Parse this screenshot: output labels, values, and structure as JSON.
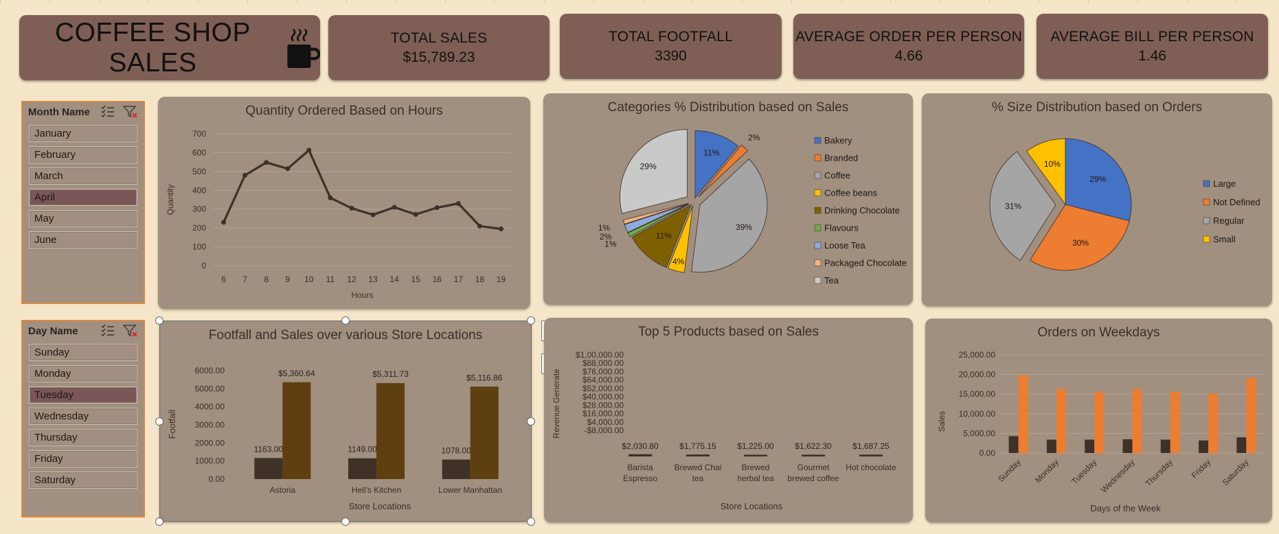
{
  "header": {
    "title": "COFFEE SHOP SALES",
    "kpis": [
      {
        "label": "TOTAL SALES",
        "value": "$15,789.23"
      },
      {
        "label": "TOTAL FOOTFALL",
        "value": "3390"
      },
      {
        "label": "AVERAGE ORDER PER PERSON",
        "value": "4.66"
      },
      {
        "label": "AVERAGE BILL PER PERSON",
        "value": "1.46"
      }
    ]
  },
  "month_slicer": {
    "header": "Month Name",
    "items": [
      "January",
      "February",
      "March",
      "April",
      "May",
      "June"
    ],
    "selected": "April"
  },
  "day_slicer": {
    "header": "Day Name",
    "items": [
      "Sunday",
      "Monday",
      "Tuesday",
      "Wednesday",
      "Thursday",
      "Friday",
      "Saturday"
    ],
    "selected": "Tuesday"
  },
  "chart_data": [
    {
      "id": "hours",
      "type": "line",
      "title": "Quantity Ordered Based on Hours",
      "xlabel": "Hours",
      "ylabel": "Quantity",
      "x": [
        6,
        7,
        8,
        9,
        10,
        11,
        12,
        13,
        14,
        15,
        16,
        17,
        18,
        19
      ],
      "values": [
        230,
        480,
        548,
        515,
        613,
        360,
        305,
        270,
        310,
        272,
        308,
        330,
        210,
        195
      ],
      "ylim": [
        0,
        700
      ],
      "yticks": [
        0,
        100,
        200,
        300,
        400,
        500,
        600,
        700
      ],
      "color": "#3e3128"
    },
    {
      "id": "categories",
      "type": "pie",
      "title": "Categories % Distribution based on Sales",
      "labels": [
        "Bakery",
        "Branded",
        "Coffee",
        "Coffee beans",
        "Drinking Chocolate",
        "Flavours",
        "Loose Tea",
        "Packaged Chocolate",
        "Tea"
      ],
      "values": [
        11,
        2,
        39,
        4,
        11,
        1,
        2,
        1,
        29
      ],
      "data_labels": [
        "11%",
        "2%",
        "39%",
        "4%",
        "11%",
        "1%",
        "2%",
        "1%",
        "29%"
      ],
      "colors": [
        "#4472c4",
        "#ed7d31",
        "#a5a5a5",
        "#ffc000",
        "#7f6000",
        "#70ad47",
        "#8faadc",
        "#f4b183",
        "#c9c9c9"
      ]
    },
    {
      "id": "sizes",
      "type": "pie",
      "title": "% Size Distribution based on Orders",
      "labels": [
        "Large",
        "Not Defined",
        "Regular",
        "Small"
      ],
      "values": [
        29,
        30,
        31,
        10
      ],
      "data_labels": [
        "29%",
        "30%",
        "31%",
        "10%"
      ],
      "colors": [
        "#4472c4",
        "#ed7d31",
        "#a5a5a5",
        "#ffc000"
      ]
    },
    {
      "id": "footfall",
      "type": "bar",
      "title": "Footfall and Sales over various Store Locations",
      "xlabel": "Store Locations",
      "ylabel": "Footfall",
      "categories": [
        "Astoria",
        "Hell's Kitchen",
        "Lower Manhattan"
      ],
      "series": [
        {
          "values": [
            1163,
            1149,
            1078
          ],
          "labels": [
            "1163.00",
            "1149.00",
            "1078.00"
          ],
          "color": "#3e3128"
        },
        {
          "values": [
            5360.64,
            5311.73,
            5116.86
          ],
          "labels": [
            "$5,360.64",
            "$5,311.73",
            "$5,116.86"
          ],
          "color": "#5e4010"
        }
      ],
      "ylim": [
        0,
        6000
      ],
      "yticks": [
        "0.00",
        "1000.00",
        "2000.00",
        "3000.00",
        "4000.00",
        "5000.00",
        "6000.00"
      ]
    },
    {
      "id": "top5",
      "type": "bar",
      "title": "Top 5 Products based on Sales",
      "xlabel": "Store Locations",
      "ylabel": "Revenue Generate",
      "categories": [
        [
          "Barista",
          "Espresso"
        ],
        [
          "Brewed Chai",
          "tea"
        ],
        [
          "Brewed",
          "herbal tea"
        ],
        [
          "Gourmet",
          "brewed coffee"
        ],
        [
          "Hot chocolate"
        ]
      ],
      "values": [
        2030.8,
        1775.15,
        1225.0,
        1622.3,
        1687.25
      ],
      "labels": [
        "$2,030.80",
        "$1,775.15",
        "$1,225.00",
        "$1,622.30",
        "$1,687.25"
      ],
      "ylim": [
        -8000,
        100000
      ],
      "yticks": [
        "$1,00,000.00",
        "$88,000.00",
        "$76,000.00",
        "$64,000.00",
        "$52,000.00",
        "$40,000.00",
        "$28,000.00",
        "$16,000.00",
        "$4,000.00",
        "-$8,000.00"
      ],
      "color": "#3e3128"
    },
    {
      "id": "weekdays",
      "type": "bar",
      "title": "Orders on Weekdays",
      "xlabel": "Days of the Week",
      "ylabel": "Sales",
      "categories": [
        "Sunday",
        "Monday",
        "Tuesday",
        "Wednesday",
        "Thursday",
        "Friday",
        "Saturday"
      ],
      "series": [
        {
          "values": [
            4300,
            3400,
            3400,
            3500,
            3400,
            3200,
            4000
          ],
          "color": "#3e3128"
        },
        {
          "values": [
            19800,
            16300,
            15500,
            16300,
            15600,
            15100,
            19100
          ],
          "color": "#ed7d31"
        }
      ],
      "ylim": [
        0,
        25000
      ],
      "yticks": [
        "0.00",
        "5,000.00",
        "10,000.00",
        "15,000.00",
        "20,000.00",
        "25,000.00"
      ]
    }
  ]
}
